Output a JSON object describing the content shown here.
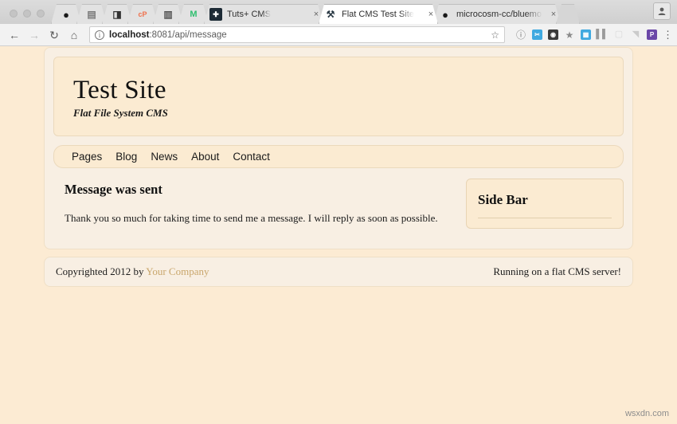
{
  "browser": {
    "window_controls": [
      "close",
      "minimize",
      "maximize"
    ],
    "pinned_tabs": [
      {
        "name": "pinned-tab-1",
        "favicon": "dark-circle-icon",
        "glyph": "●"
      },
      {
        "name": "pinned-tab-2",
        "favicon": "grey-book-icon",
        "glyph": "▤"
      },
      {
        "name": "pinned-tab-3",
        "favicon": "dark-shape-icon",
        "glyph": "◨"
      },
      {
        "name": "pinned-tab-4",
        "favicon": "cpanel-icon",
        "glyph": "cP"
      },
      {
        "name": "pinned-tab-5",
        "favicon": "dictionary-icon",
        "glyph": "▥"
      },
      {
        "name": "pinned-tab-6",
        "favicon": "mailchimp-icon",
        "glyph": "M"
      }
    ],
    "tabs": [
      {
        "title": "Tuts+ CMS",
        "favicon": "tutsplus-icon",
        "glyph": "✚",
        "active": false,
        "close": "×"
      },
      {
        "title": "Flat CMS Test Site",
        "favicon": "hammer-icon",
        "glyph": "⚒",
        "active": true,
        "close": "×"
      },
      {
        "title": "microcosm-cc/bluemonday: b",
        "favicon": "github-icon",
        "glyph": "●",
        "active": false,
        "close": "×"
      }
    ],
    "new_tab_label": "",
    "profile_icon": "profile-avatar-icon",
    "nav": {
      "back": "←",
      "forward": "→",
      "reload": "↻",
      "home": "⌂"
    },
    "omnibox": {
      "security_icon": "info-circle-icon",
      "url_host": "localhost",
      "url_rest": ":8081/api/message",
      "full_url": "localhost:8081/api/message",
      "bookmark_star": "☆"
    },
    "extensions": [
      {
        "name": "info-extension-icon",
        "glyph": "ⓘ",
        "color": "#777777",
        "type": "glyph"
      },
      {
        "name": "scissors-extension-icon",
        "glyph": "✂",
        "color": "#3FA9E0",
        "type": "square"
      },
      {
        "name": "glasses-extension-icon",
        "glyph": "◕",
        "color": "#3A3A3A",
        "type": "square"
      },
      {
        "name": "star-extension-icon",
        "glyph": "★",
        "color": "#8B8B8B",
        "type": "glyph"
      },
      {
        "name": "trello-extension-icon",
        "glyph": "▦",
        "color": "#3FA9E0",
        "type": "square"
      },
      {
        "name": "bars-extension-icon",
        "glyph": "▐",
        "color": "#9B9B9B",
        "type": "glyph"
      },
      {
        "name": "faded-extension-icon",
        "glyph": "▢",
        "color": "#D2D2D2",
        "type": "glyph"
      },
      {
        "name": "faded2-extension-icon",
        "glyph": "◥",
        "color": "#C6C6C6",
        "type": "glyph"
      },
      {
        "name": "pocket-extension-icon",
        "glyph": "P",
        "color": "#6B47A8",
        "type": "square"
      }
    ],
    "menu_icon": "⋮"
  },
  "site": {
    "title": "Test Site",
    "tagline": "Flat File System CMS",
    "nav_items": [
      {
        "label": "Pages"
      },
      {
        "label": "Blog"
      },
      {
        "label": "News"
      },
      {
        "label": "About"
      },
      {
        "label": "Contact"
      }
    ],
    "content": {
      "heading": "Message was sent",
      "paragraph": "Thank you so much for taking time to send me a message. I will reply as soon as possible."
    },
    "sidebar": {
      "heading": "Side Bar"
    },
    "footer": {
      "copyright_prefix": "Copyrighted 2012 by ",
      "company_link": "Your Company",
      "right_text": "Running on a flat CMS server!"
    }
  },
  "watermark": "wsxdn.com",
  "colors": {
    "page_background": "#FCEBD3",
    "panel_background": "#F8EFE3",
    "box_background": "#FBEBD2",
    "box_border": "#EBD9BC",
    "link_accent": "#C9A66B",
    "text": "#1A1A1A"
  }
}
